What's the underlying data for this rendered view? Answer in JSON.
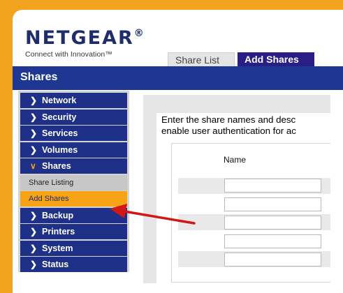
{
  "brand": {
    "logo_text": "NETGEAR",
    "logo_mark": "®",
    "tagline": "Connect with Innovation™"
  },
  "tabs": [
    {
      "label": "Share List",
      "active": false
    },
    {
      "label": "Add Shares",
      "active": true
    }
  ],
  "page_title": "Shares",
  "sidebar": {
    "items": [
      {
        "label": "Network",
        "expanded": false
      },
      {
        "label": "Security",
        "expanded": false
      },
      {
        "label": "Services",
        "expanded": false
      },
      {
        "label": "Volumes",
        "expanded": false
      },
      {
        "label": "Shares",
        "expanded": true
      },
      {
        "label": "Backup",
        "expanded": false
      },
      {
        "label": "Printers",
        "expanded": false
      },
      {
        "label": "System",
        "expanded": false
      },
      {
        "label": "Status",
        "expanded": false
      }
    ],
    "sub_items": [
      {
        "label": "Share Listing",
        "selected": false
      },
      {
        "label": "Add Shares",
        "selected": true
      }
    ]
  },
  "main": {
    "description_line1": "Enter the share names and desc",
    "description_line2": "enable user authentication for ac",
    "table": {
      "columns": [
        "Name"
      ],
      "rows": [
        {
          "name": ""
        },
        {
          "name": ""
        },
        {
          "name": ""
        },
        {
          "name": ""
        },
        {
          "name": ""
        }
      ]
    }
  },
  "colors": {
    "accent_orange": "#f2a21d",
    "nav_blue": "#1e3088",
    "title_blue": "#1e3793",
    "tab_active": "#2b1d86",
    "annotation_arrow": "#d01818"
  },
  "icons": {
    "nav_collapsed": "chevron-right-icon",
    "nav_expanded": "chevron-down-icon",
    "annotation": "red-arrow-icon"
  }
}
